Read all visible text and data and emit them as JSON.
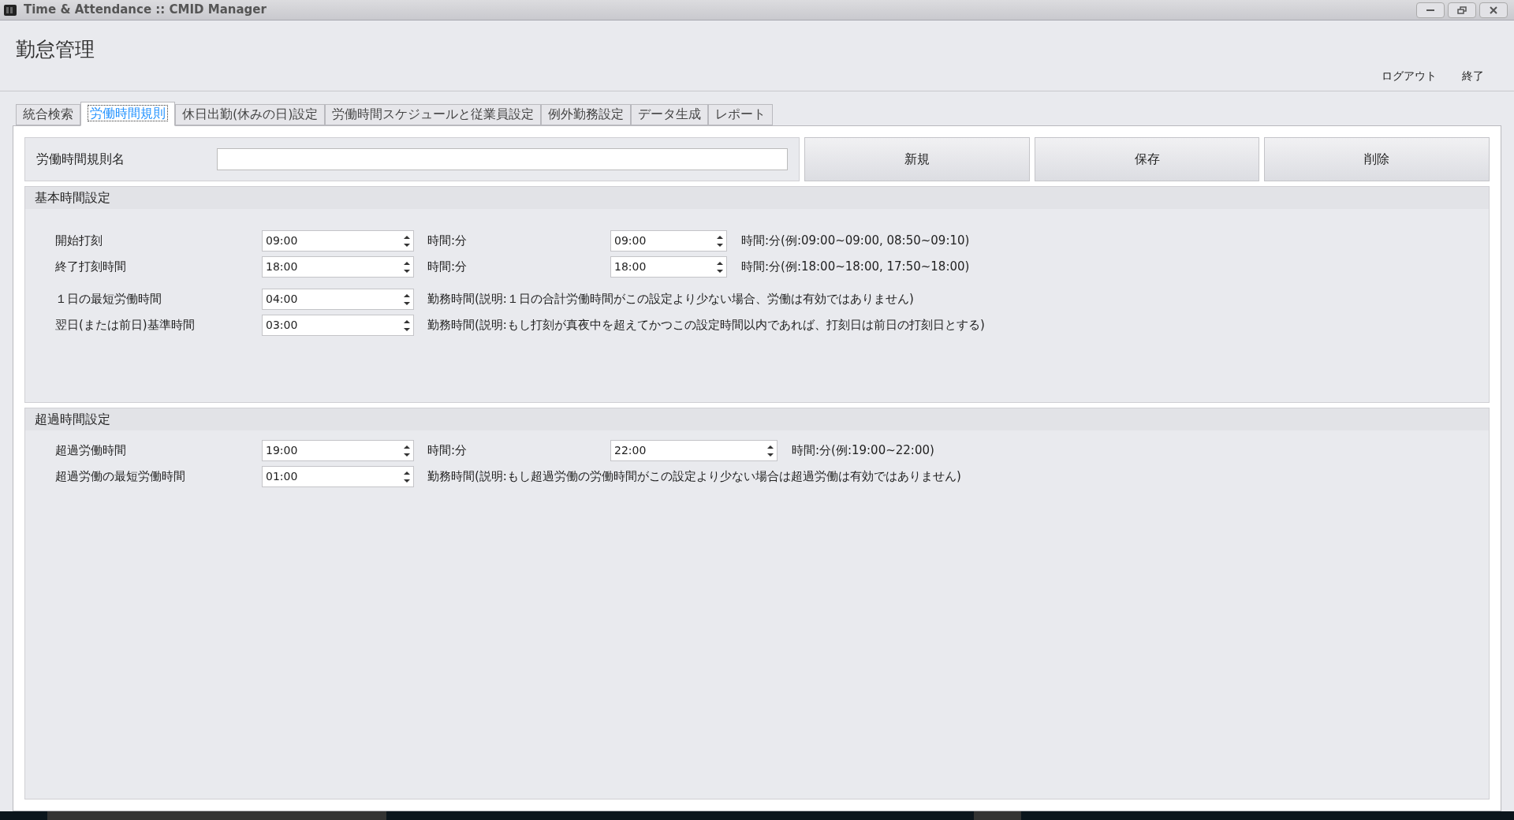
{
  "window": {
    "title": "Time & Attendance :: CMID Manager"
  },
  "header": {
    "title": "勤怠管理",
    "links": [
      "ログアウト",
      "終了"
    ]
  },
  "tabs": [
    {
      "label": "統合検索",
      "selected": false
    },
    {
      "label": "労働時間規則",
      "selected": true
    },
    {
      "label": "休日出勤(休みの日)設定",
      "selected": false
    },
    {
      "label": "労働時間スケジュールと従業員設定",
      "selected": false
    },
    {
      "label": "例外勤務設定",
      "selected": false
    },
    {
      "label": "データ生成",
      "selected": false
    },
    {
      "label": "レポート",
      "selected": false
    }
  ],
  "rule_name": {
    "label": "労働時間規則名"
  },
  "buttons": [
    "新規",
    "保存",
    "削除"
  ],
  "sections": [
    {
      "title": "基本時間設定",
      "rows": [
        {
          "kind": "pair",
          "label": "開始打刻",
          "value": "09:00",
          "unit": "時間:分",
          "value_2": "09:00",
          "note": "時間:分(例:09:00~09:00, 08:50~09:10)"
        },
        {
          "kind": "pair",
          "label": "終了打刻時間",
          "value": "18:00",
          "unit": "時間:分",
          "value_2": "18:00",
          "note": "時間:分(例:18:00~18:00, 17:50~18:00)"
        },
        {
          "kind": "single",
          "label": "１日の最短労働時間",
          "value": "04:00",
          "note": "勤務時間(説明:１日の合計労働時間がこの設定より少ない場合、労働は有効ではありません)"
        },
        {
          "kind": "single",
          "label": "翌日(または前日)基準時間",
          "value": "03:00",
          "note": "勤務時間(説明:もし打刻が真夜中を超えてかつこの設定時間以内であれば、打刻日は前日の打刻日とする)"
        }
      ]
    },
    {
      "title": "超過時間設定",
      "rows": [
        {
          "kind": "wide",
          "label": "超過労働時間",
          "value": "19:00",
          "unit": "時間:分",
          "value_2": "22:00",
          "note": "時間:分(例:19:00~22:00)"
        },
        {
          "kind": "single",
          "label": "超過労働の最短労働時間",
          "value": "01:00",
          "note": "勤務時間(説明:もし超過労働の労働時間がこの設定より少ない場合は超過労働は有効ではありません)"
        }
      ]
    }
  ]
}
